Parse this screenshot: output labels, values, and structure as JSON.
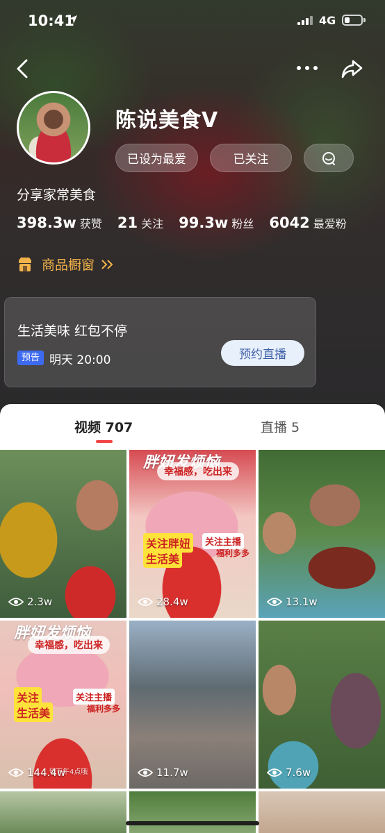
{
  "status_bar": {
    "time": "10:41",
    "network": "4G"
  },
  "nav": {
    "back": "back-icon",
    "more": "more-icon",
    "share": "share-icon"
  },
  "profile": {
    "name": "陈说美食V",
    "bio": "分享家常美食",
    "buttons": {
      "favorite": "已设为最爱",
      "following": "已关注",
      "message_icon": "chat-icon"
    },
    "stats": [
      {
        "num": "398.3w",
        "label": "获赞"
      },
      {
        "num": "21",
        "label": "关注"
      },
      {
        "num": "99.3w",
        "label": "粉丝"
      },
      {
        "num": "6042",
        "label": "最爱粉"
      }
    ],
    "shop": {
      "label": "商品橱窗"
    }
  },
  "live_card": {
    "title": "生活美味 红包不停",
    "tag": "预告",
    "time": "明天 20:00",
    "button": "预约直播"
  },
  "tabs": [
    {
      "label": "视频 707",
      "active": true
    },
    {
      "label": "直播 5",
      "active": false
    }
  ],
  "videos": [
    {
      "views": "2.3w"
    },
    {
      "views": "28.4w",
      "overlay": {
        "top": "胖妞发烦恼",
        "sub": "幸福感，吃出来",
        "badge1": "关注胖妞",
        "badge1b": "生活美",
        "badge2": "关注主播",
        "badge3": "福利多多"
      }
    },
    {
      "views": "13.1w"
    },
    {
      "views": "144.4w",
      "overlay": {
        "top": "胖妞发烦恼",
        "sub": "幸福感，吃出来",
        "badge1": "关注",
        "badge1b": "生活美",
        "badge2": "关注主播",
        "badge3": "福利多多",
        "caption": "号下午4点哦"
      }
    },
    {
      "views": "11.7w"
    },
    {
      "views": "7.6w"
    }
  ],
  "colors": {
    "accent_red": "#f24545",
    "shop_orange": "#f2b24a",
    "tag_blue": "#3d6bf0"
  }
}
